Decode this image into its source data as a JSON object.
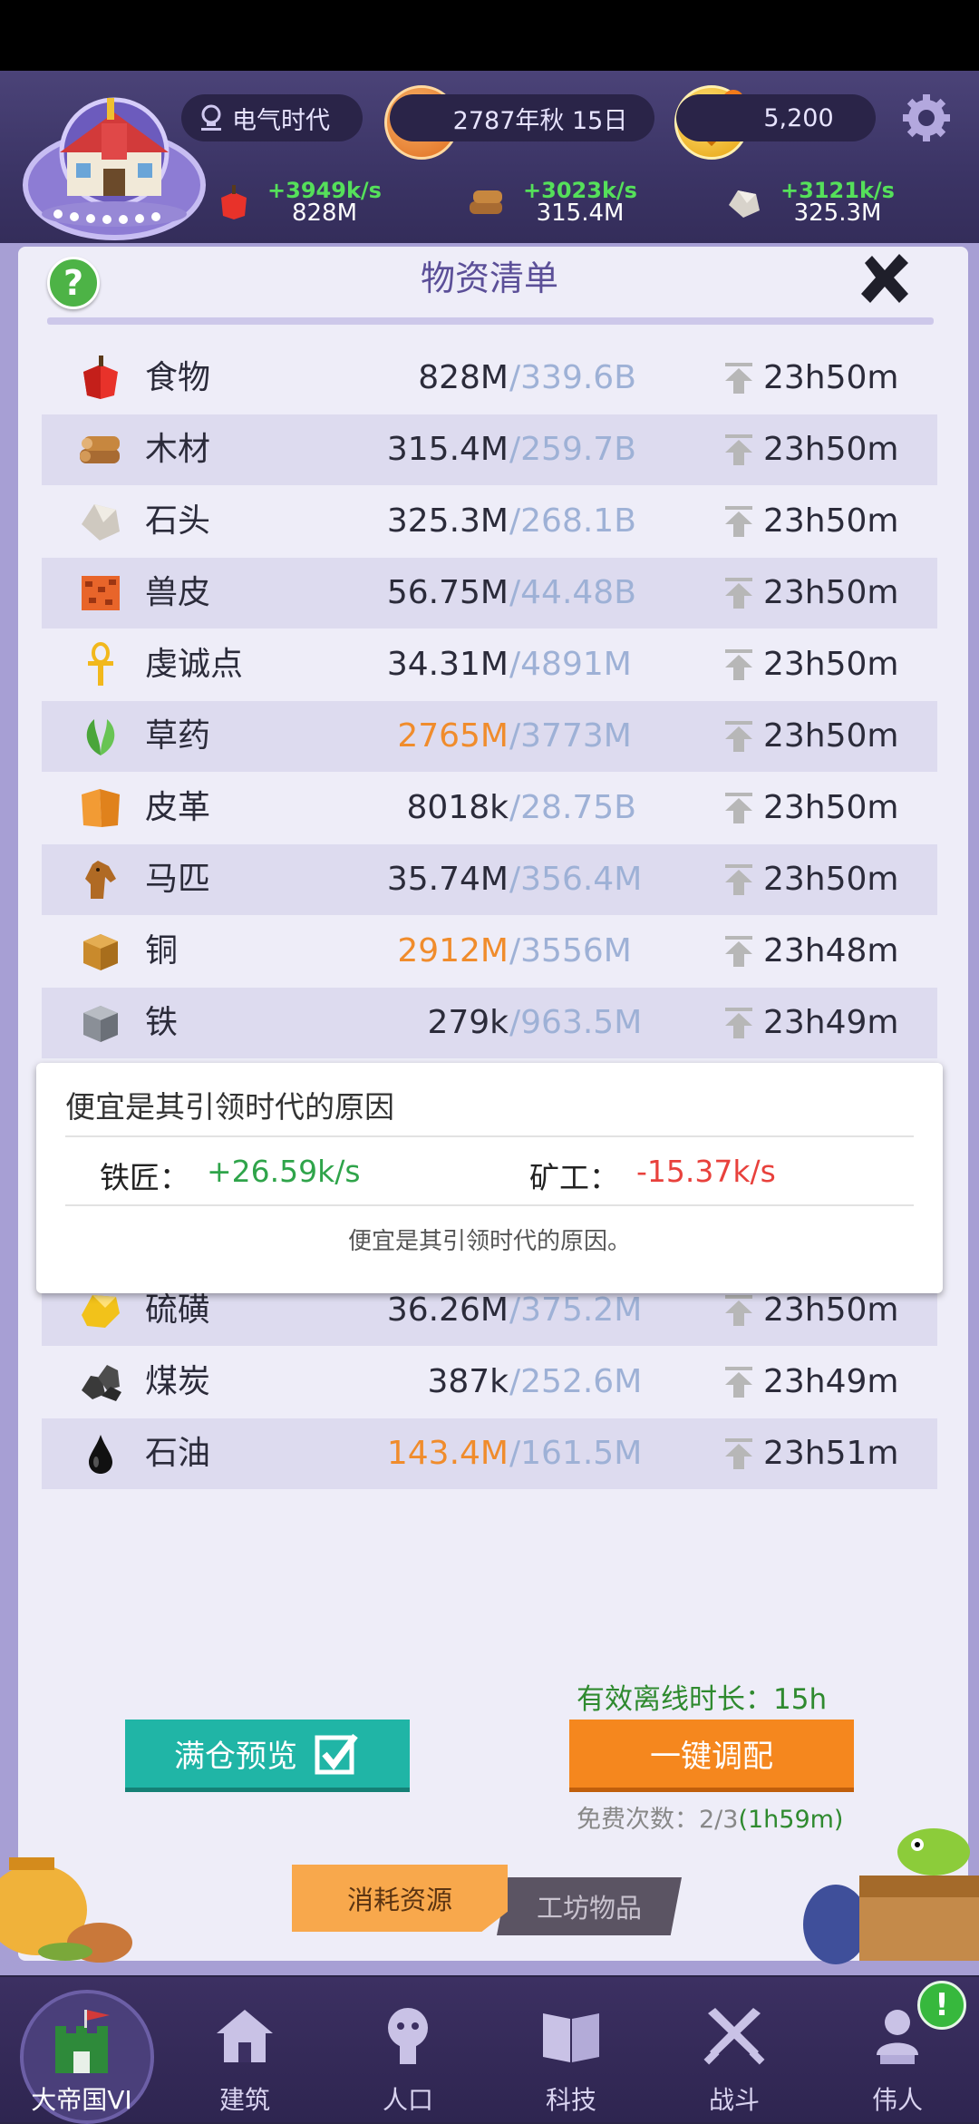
{
  "header": {
    "era": "电气时代",
    "date": "2787年秋 15日",
    "coins": "5,200"
  },
  "top_resources": [
    {
      "rate": "+3949k/s",
      "amount": "828M"
    },
    {
      "rate": "+3023k/s",
      "amount": "315.4M"
    },
    {
      "rate": "+3121k/s",
      "amount": "325.3M"
    }
  ],
  "panel": {
    "title": "物资清单",
    "help": "?"
  },
  "resources": [
    {
      "name": "食物",
      "amount": "828M",
      "cap": "/339.6B",
      "time": "23h50m",
      "warn": false,
      "icon": "apple-icon"
    },
    {
      "name": "木材",
      "amount": "315.4M",
      "cap": "/259.7B",
      "time": "23h50m",
      "warn": false,
      "icon": "wood-icon"
    },
    {
      "name": "石头",
      "amount": "325.3M",
      "cap": "/268.1B",
      "time": "23h50m",
      "warn": false,
      "icon": "stone-icon"
    },
    {
      "name": "兽皮",
      "amount": "56.75M",
      "cap": "/44.48B",
      "time": "23h50m",
      "warn": false,
      "icon": "hide-icon"
    },
    {
      "name": "虔诚点",
      "amount": "34.31M",
      "cap": "/4891M",
      "time": "23h50m",
      "warn": false,
      "icon": "ankh-icon"
    },
    {
      "name": "草药",
      "amount": "2765M",
      "cap": "/3773M",
      "time": "23h50m",
      "warn": true,
      "icon": "herb-icon"
    },
    {
      "name": "皮革",
      "amount": "8018k",
      "cap": "/28.75B",
      "time": "23h50m",
      "warn": false,
      "icon": "leather-icon"
    },
    {
      "name": "马匹",
      "amount": "35.74M",
      "cap": "/356.4M",
      "time": "23h50m",
      "warn": false,
      "icon": "horse-icon"
    },
    {
      "name": "铜",
      "amount": "2912M",
      "cap": "/3556M",
      "time": "23h48m",
      "warn": true,
      "icon": "copper-icon"
    },
    {
      "name": "铁",
      "amount": "279k",
      "cap": "/963.5M",
      "time": "23h49m",
      "warn": false,
      "icon": "iron-icon"
    },
    {
      "name": "硫磺",
      "amount": "36.26M",
      "cap": "/375.2M",
      "time": "23h50m",
      "warn": false,
      "icon": "sulfur-icon"
    },
    {
      "name": "煤炭",
      "amount": "387k",
      "cap": "/252.6M",
      "time": "23h49m",
      "warn": false,
      "icon": "coal-icon"
    },
    {
      "name": "石油",
      "amount": "143.4M",
      "cap": "/161.5M",
      "time": "23h51m",
      "warn": true,
      "icon": "oil-icon"
    }
  ],
  "tooltip": {
    "title": "便宜是其引领时代的原因",
    "producer_label": "铁匠：",
    "producer_value": "+26.59k/s",
    "consumer_label": "矿工：",
    "consumer_value": "-15.37k/s",
    "note": "便宜是其引领时代的原因。"
  },
  "actions": {
    "offline": "有效离线时长：15h",
    "preview_button": "满仓预览",
    "allocate_button": "一键调配",
    "free_count_prefix": "免费次数：2/3",
    "free_count_timer": "(1h59m)"
  },
  "tabs": {
    "active": "消耗资源",
    "inactive": "工坊物品"
  },
  "nav": [
    {
      "label": "大帝国VI"
    },
    {
      "label": "建筑"
    },
    {
      "label": "人口"
    },
    {
      "label": "科技"
    },
    {
      "label": "战斗"
    },
    {
      "label": "伟人"
    }
  ],
  "alert": "!",
  "colors": {
    "rate_green": "#55e05a",
    "warn_orange": "#f08c2c",
    "positive": "#2fa44a",
    "negative": "#e8413c",
    "button_teal": "#20b5a6",
    "button_orange": "#f5871e"
  }
}
